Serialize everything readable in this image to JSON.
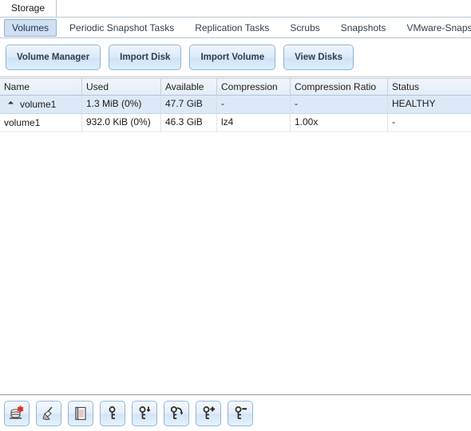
{
  "window": {
    "tabs": [
      {
        "label": "Storage",
        "active": true
      }
    ]
  },
  "subtabs": [
    {
      "label": "Volumes",
      "active": true
    },
    {
      "label": "Periodic Snapshot Tasks",
      "active": false
    },
    {
      "label": "Replication Tasks",
      "active": false
    },
    {
      "label": "Scrubs",
      "active": false
    },
    {
      "label": "Snapshots",
      "active": false
    },
    {
      "label": "VMware-Snapshot",
      "active": false
    }
  ],
  "actions": [
    {
      "label": "Volume Manager",
      "name": "volume-manager-button"
    },
    {
      "label": "Import Disk",
      "name": "import-disk-button"
    },
    {
      "label": "Import Volume",
      "name": "import-volume-button"
    },
    {
      "label": "View Disks",
      "name": "view-disks-button"
    }
  ],
  "grid": {
    "columns": [
      {
        "label": "Name"
      },
      {
        "label": "Used"
      },
      {
        "label": "Available"
      },
      {
        "label": "Compression"
      },
      {
        "label": "Compression Ratio"
      },
      {
        "label": "Status"
      }
    ],
    "rows": [
      {
        "name": "volume1",
        "used": "1.3 MiB (0%)",
        "available": "47.7 GiB",
        "compression": "-",
        "compression_ratio": "-",
        "status": "HEALTHY",
        "selected": true,
        "expandable": true,
        "child": false
      },
      {
        "name": "volume1",
        "used": "932.0 KiB (0%)",
        "available": "46.3 GiB",
        "compression": "lz4",
        "compression_ratio": "1.00x",
        "status": "-",
        "selected": false,
        "expandable": false,
        "child": true
      }
    ]
  },
  "bottom_toolbar": [
    {
      "name": "detach-volume-icon",
      "icon": "disk-stack-remove"
    },
    {
      "name": "scrub-volume-icon",
      "icon": "broom"
    },
    {
      "name": "volume-status-icon",
      "icon": "document"
    },
    {
      "name": "unlock-icon",
      "icon": "key"
    },
    {
      "name": "download-key-icon",
      "icon": "key-down"
    },
    {
      "name": "restore-key-icon",
      "icon": "key-arrow"
    },
    {
      "name": "add-recovery-key-icon",
      "icon": "key-plus"
    },
    {
      "name": "remove-recovery-key-icon",
      "icon": "key-minus"
    }
  ],
  "colors": {
    "accent": "#8db4d8",
    "selected_row": "#dce9f7",
    "button_face": "#dcebf9",
    "red_badge": "#e02b20"
  }
}
